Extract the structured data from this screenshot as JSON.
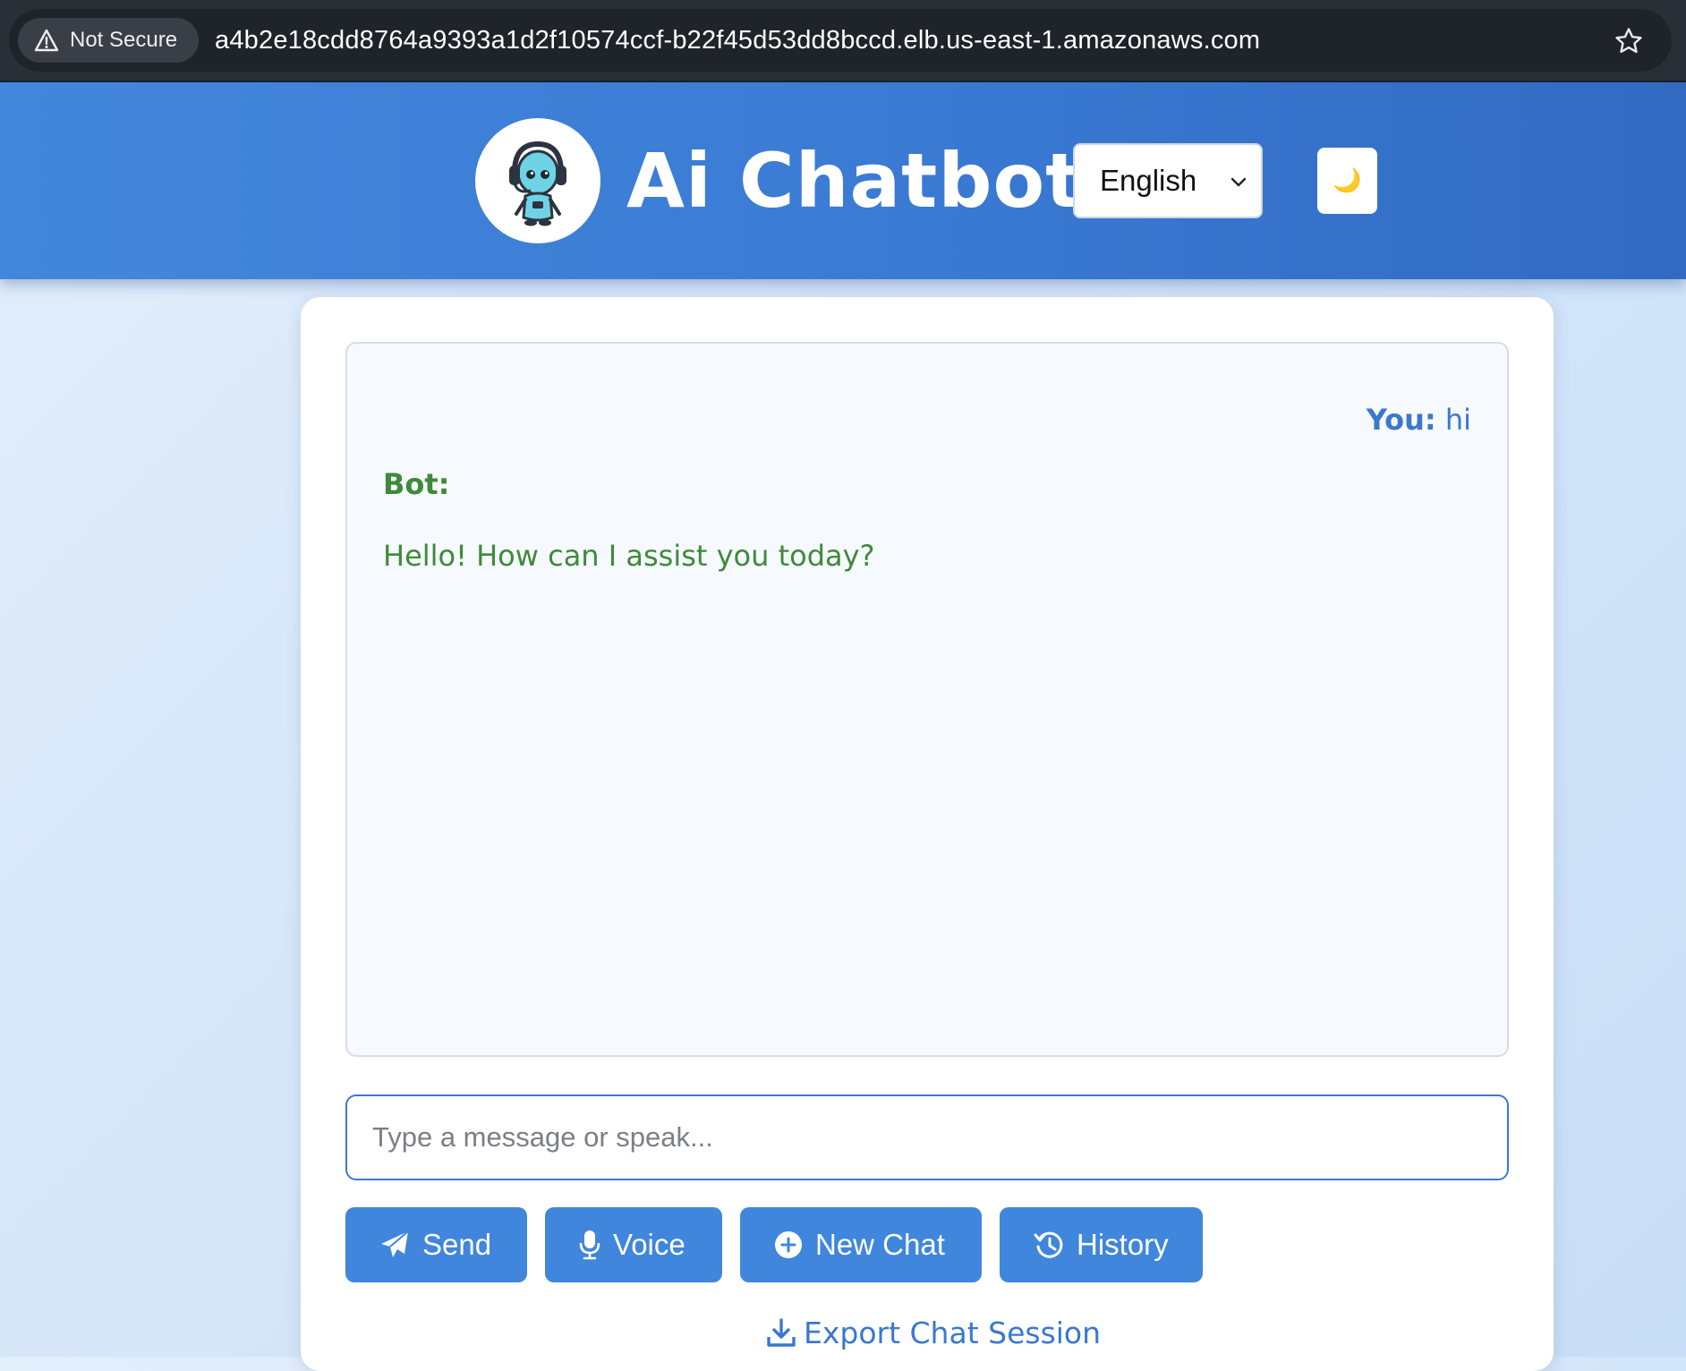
{
  "browser": {
    "security_label": "Not Secure",
    "url": "a4b2e18cdd8764a9393a1d2f10574ccf-b22f45d53dd8bccd.elb.us-east-1.amazonaws.com"
  },
  "header": {
    "title": "Ai Chatbot",
    "language_selected": "English",
    "theme_icon": "🌙",
    "accent_color": "#3a7ad3"
  },
  "chat": {
    "messages": [
      {
        "sender": "You:",
        "text": "hi"
      },
      {
        "sender": "Bot:",
        "text": "Hello! How can I assist you today?"
      }
    ],
    "user_color": "#3a78cf",
    "bot_color": "#3f8a3a"
  },
  "input": {
    "placeholder": "Type a message or speak...",
    "value": ""
  },
  "actions": {
    "send_label": "Send",
    "voice_label": "Voice",
    "new_chat_label": "New Chat",
    "history_label": "History",
    "export_label": "Export Chat Session"
  }
}
